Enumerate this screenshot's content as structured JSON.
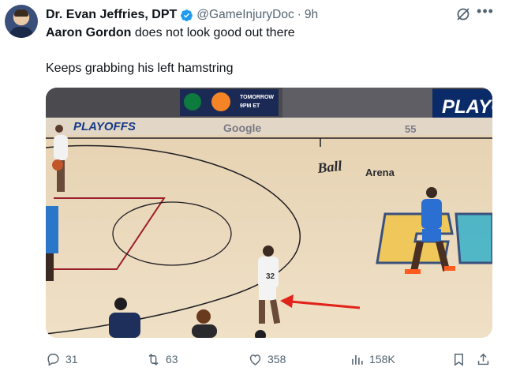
{
  "tweet": {
    "author_name": "Dr. Evan Jeffries, DPT",
    "handle": "@GameInjuryDoc",
    "separator": "·",
    "time": "9h",
    "mention": "Aaron Gordon",
    "line1_rest": " does not look good out there",
    "line2": "Keeps grabbing his left hamstring",
    "icons": {
      "avatar": "profile-photo",
      "verified": "verified-badge-icon",
      "grok": "grok-icon",
      "more": "more-icon"
    },
    "colors": {
      "verified": "#1d9bf0",
      "secondary_text": "#536471",
      "arrow": "#e2231a"
    }
  },
  "media": {
    "signage": {
      "playoffs_left": "PLAYOFFS",
      "google": "Google",
      "arena_line1": "Ball",
      "arena_line2": "Arena",
      "playoffs_right": "PLAYO",
      "jersey": "32",
      "scoreboard_number": "55",
      "banner_top": "TOMORROW",
      "banner_bottom": "9PM ET"
    }
  },
  "actions": {
    "replies": "31",
    "reposts": "63",
    "likes": "358",
    "views": "158K",
    "icons": [
      "reply-icon",
      "repost-icon",
      "like-icon",
      "views-icon",
      "bookmark-icon",
      "share-icon"
    ]
  }
}
